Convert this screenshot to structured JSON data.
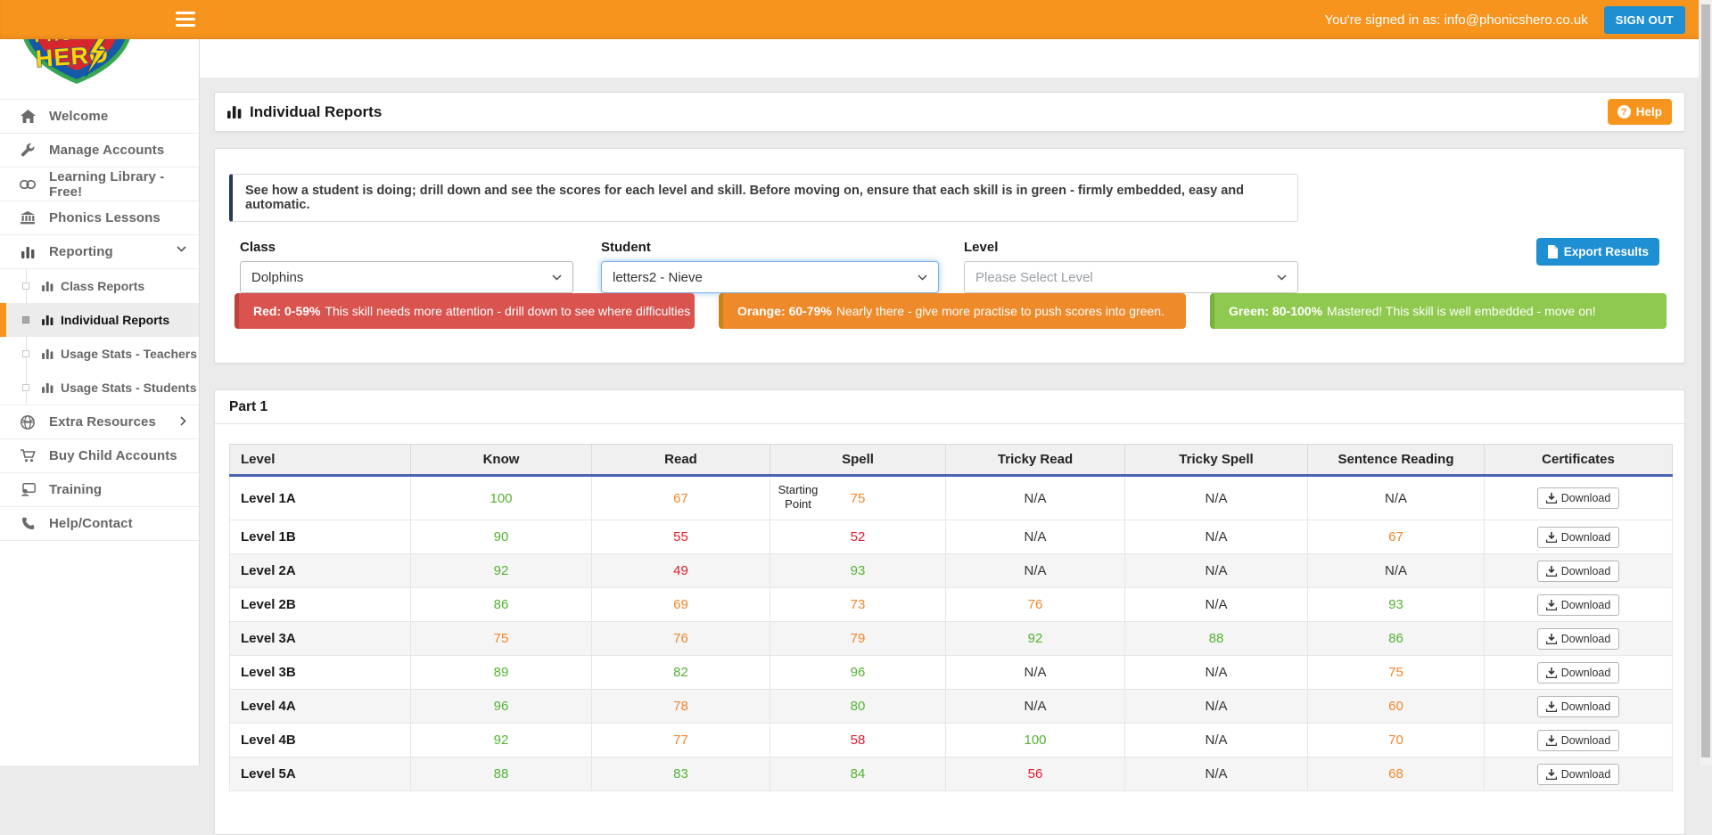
{
  "topbar": {
    "signed_in": "You're signed in as: info@phonicshero.co.uk",
    "sign_out": "SIGN OUT"
  },
  "logo": {
    "word1": "PHONICS",
    "word2": "HERO"
  },
  "sidebar": {
    "items": [
      {
        "label": "Welcome",
        "icon": "home-icon"
      },
      {
        "label": "Manage Accounts",
        "icon": "wrench-icon"
      },
      {
        "label": "Learning Library - Free!",
        "icon": "link-icon"
      },
      {
        "label": "Phonics Lessons",
        "icon": "bank-icon"
      },
      {
        "label": "Reporting",
        "icon": "bar-chart-icon"
      }
    ],
    "reporting_sub": [
      {
        "label": "Class Reports",
        "active": false
      },
      {
        "label": "Individual Reports",
        "active": true
      },
      {
        "label": "Usage Stats - Teachers",
        "active": false
      },
      {
        "label": "Usage Stats - Students",
        "active": false
      }
    ],
    "items_bottom": [
      {
        "label": "Extra Resources",
        "icon": "globe-icon"
      },
      {
        "label": "Buy Child Accounts",
        "icon": "cart-icon"
      },
      {
        "label": "Training",
        "icon": "training-icon"
      },
      {
        "label": "Help/Contact",
        "icon": "phone-icon"
      }
    ]
  },
  "page": {
    "title": "Individual Reports",
    "help": "Help"
  },
  "filters": {
    "intro": "See how a student is doing; drill down and see the scores for each level and skill. Before moving on, ensure that each skill is in green - firmly embedded, easy and automatic.",
    "class_label": "Class",
    "class_value": "Dolphins",
    "student_label": "Student",
    "student_value": "letters2 - Nieve",
    "level_label": "Level",
    "level_placeholder": "Please Select Level",
    "export": "Export Results"
  },
  "legend": [
    {
      "strong": "Red: 0-59%",
      "text": "This skill needs more attention - drill down to see where difficulties lie.",
      "bg": "#D9534F",
      "accent": "#BE433F"
    },
    {
      "strong": "Orange: 60-79%",
      "text": "Nearly there - give more practise to push scores into green.",
      "bg": "#EF8A2B",
      "accent": "#C8821C"
    },
    {
      "strong": "Green: 80-100%",
      "text": "Mastered! This skill is well embedded - move on!",
      "bg": "#8FC94F",
      "accent": "#78B23A"
    }
  ],
  "report": {
    "section": "Part 1",
    "columns": [
      "Level",
      "Know",
      "Read",
      "Spell",
      "Tricky Read",
      "Tricky Spell",
      "Sentence Reading",
      "Certificates"
    ],
    "download": "Download",
    "note": "Starting Point",
    "rows": [
      {
        "level": "Level 1A",
        "know": {
          "v": "100",
          "c": "green"
        },
        "read": {
          "v": "67",
          "c": "orange"
        },
        "spell": {
          "v": "75",
          "c": "orange"
        },
        "tricky_read": {
          "v": "N/A",
          "c": "na"
        },
        "tricky_spell": {
          "v": "N/A",
          "c": "na"
        },
        "sentence_reading": {
          "v": "N/A",
          "c": "na"
        }
      },
      {
        "level": "Level 1B",
        "know": {
          "v": "90",
          "c": "green"
        },
        "read": {
          "v": "55",
          "c": "red"
        },
        "spell": {
          "v": "52",
          "c": "red"
        },
        "tricky_read": {
          "v": "N/A",
          "c": "na"
        },
        "tricky_spell": {
          "v": "N/A",
          "c": "na"
        },
        "sentence_reading": {
          "v": "67",
          "c": "orange"
        }
      },
      {
        "level": "Level 2A",
        "know": {
          "v": "92",
          "c": "green"
        },
        "read": {
          "v": "49",
          "c": "red"
        },
        "spell": {
          "v": "93",
          "c": "green"
        },
        "tricky_read": {
          "v": "N/A",
          "c": "na"
        },
        "tricky_spell": {
          "v": "N/A",
          "c": "na"
        },
        "sentence_reading": {
          "v": "N/A",
          "c": "na"
        }
      },
      {
        "level": "Level 2B",
        "know": {
          "v": "86",
          "c": "green"
        },
        "read": {
          "v": "69",
          "c": "orange"
        },
        "spell": {
          "v": "73",
          "c": "orange"
        },
        "tricky_read": {
          "v": "76",
          "c": "orange"
        },
        "tricky_spell": {
          "v": "N/A",
          "c": "na"
        },
        "sentence_reading": {
          "v": "93",
          "c": "green"
        }
      },
      {
        "level": "Level 3A",
        "know": {
          "v": "75",
          "c": "orange"
        },
        "read": {
          "v": "76",
          "c": "orange"
        },
        "spell": {
          "v": "79",
          "c": "orange"
        },
        "tricky_read": {
          "v": "92",
          "c": "green"
        },
        "tricky_spell": {
          "v": "88",
          "c": "green"
        },
        "sentence_reading": {
          "v": "86",
          "c": "green"
        }
      },
      {
        "level": "Level 3B",
        "know": {
          "v": "89",
          "c": "green"
        },
        "read": {
          "v": "82",
          "c": "green"
        },
        "spell": {
          "v": "96",
          "c": "green"
        },
        "tricky_read": {
          "v": "N/A",
          "c": "na"
        },
        "tricky_spell": {
          "v": "N/A",
          "c": "na"
        },
        "sentence_reading": {
          "v": "75",
          "c": "orange"
        }
      },
      {
        "level": "Level 4A",
        "know": {
          "v": "96",
          "c": "green"
        },
        "read": {
          "v": "78",
          "c": "orange"
        },
        "spell": {
          "v": "80",
          "c": "green"
        },
        "tricky_read": {
          "v": "N/A",
          "c": "na"
        },
        "tricky_spell": {
          "v": "N/A",
          "c": "na"
        },
        "sentence_reading": {
          "v": "60",
          "c": "orange"
        }
      },
      {
        "level": "Level 4B",
        "know": {
          "v": "92",
          "c": "green"
        },
        "read": {
          "v": "77",
          "c": "orange"
        },
        "spell": {
          "v": "58",
          "c": "red"
        },
        "tricky_read": {
          "v": "100",
          "c": "green"
        },
        "tricky_spell": {
          "v": "N/A",
          "c": "na"
        },
        "sentence_reading": {
          "v": "70",
          "c": "orange"
        }
      },
      {
        "level": "Level 5A",
        "know": {
          "v": "88",
          "c": "green"
        },
        "read": {
          "v": "83",
          "c": "green"
        },
        "spell": {
          "v": "84",
          "c": "green"
        },
        "tricky_read": {
          "v": "56",
          "c": "red"
        },
        "tricky_spell": {
          "v": "N/A",
          "c": "na"
        },
        "sentence_reading": {
          "v": "68",
          "c": "orange"
        }
      }
    ]
  },
  "colors": {
    "topbar_orange": "#F7941E",
    "button_blue": "#1E8FD3",
    "header_rule_blue": "#4A64B5",
    "score_green": "#53B332",
    "score_orange": "#F0862B",
    "score_red": "#E8192C",
    "info_accent_navy": "#26395F"
  }
}
